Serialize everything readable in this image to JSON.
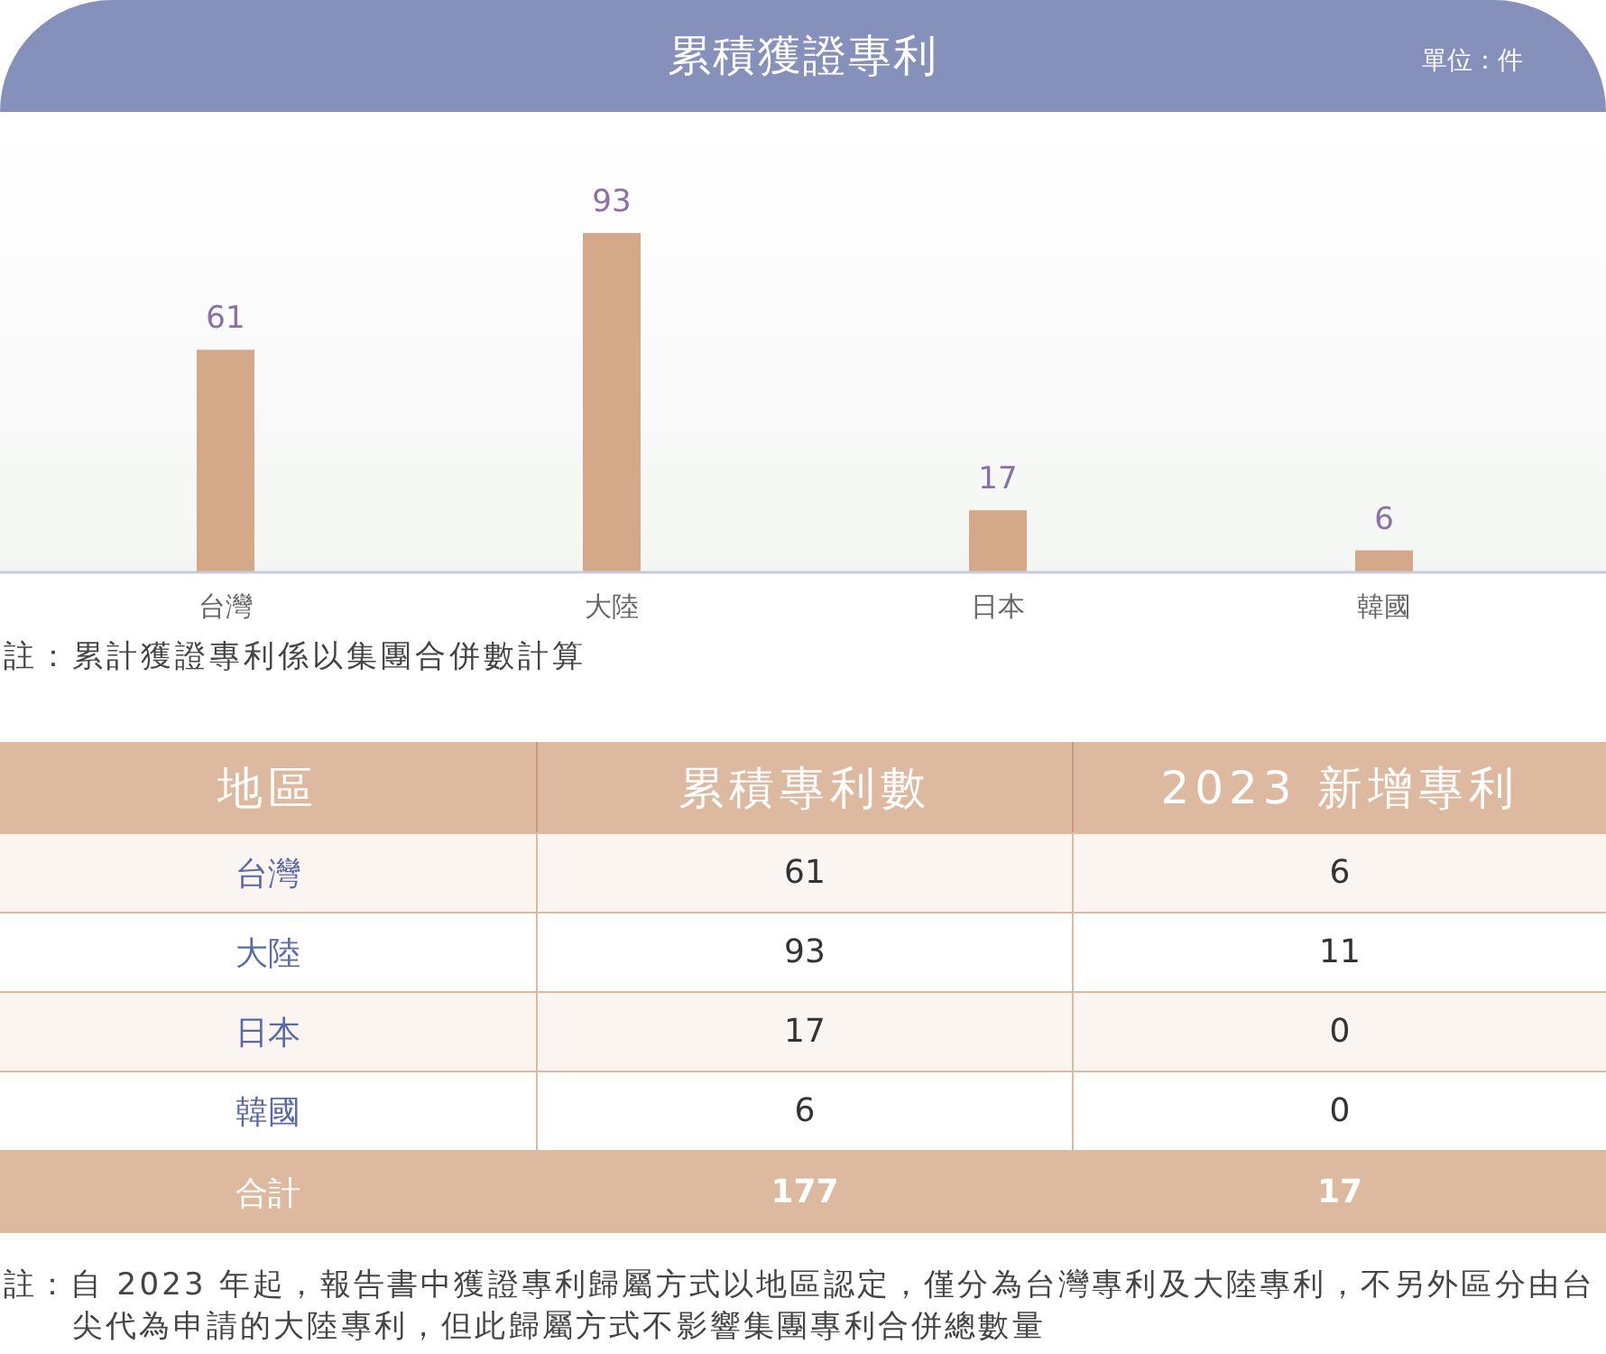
{
  "header": {
    "title": "累積獲證專利",
    "unit": "單位：件"
  },
  "chart": {
    "chart_data": {
      "type": "bar",
      "categories": [
        "台灣",
        "大陸",
        "日本",
        "韓國"
      ],
      "values": [
        61,
        93,
        17,
        6
      ],
      "value_labels": [
        "61",
        "93",
        "17",
        "6"
      ],
      "data_labels": true
    }
  },
  "chart_note": "註：累計獲證專利係以集團合併數計算",
  "table": {
    "columns": [
      "地區",
      "累積專利數",
      "2023 新增專利"
    ],
    "rows": [
      {
        "kind": "region",
        "cells": [
          "台灣",
          "61",
          "6"
        ]
      },
      {
        "kind": "region",
        "cells": [
          "大陸",
          "93",
          "11"
        ]
      },
      {
        "kind": "region",
        "cells": [
          "日本",
          "17",
          "0"
        ]
      },
      {
        "kind": "region",
        "cells": [
          "韓國",
          "6",
          "0"
        ]
      },
      {
        "kind": "total",
        "cells": [
          "合計",
          "177",
          "17"
        ]
      }
    ]
  },
  "footnote": "註：自 2023 年起，報告書中獲證專利歸屬方式以地區認定，僅分為台灣專利及大陸專利，不另外區分由台尖代為申請的大陸專利，但此歸屬方式不影響集團專利合併總數量"
}
